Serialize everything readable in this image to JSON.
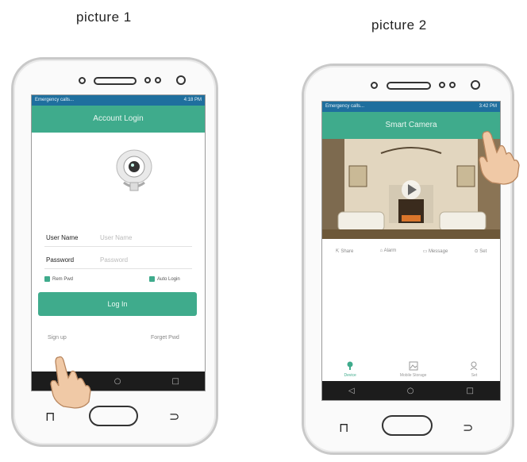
{
  "captions": {
    "picture1": "picture 1",
    "picture2": "picture 2"
  },
  "phone1": {
    "status_left": "Emergency calls...",
    "status_right": "4:18 PM",
    "title": "Account Login",
    "username_label": "User Name",
    "username_placeholder": "User Name",
    "password_label": "Password",
    "password_placeholder": "Password",
    "remember_pwd": "Rem Pwd",
    "auto_login": "Auto Login",
    "login_button": "Log In",
    "signup_link": "Sign up",
    "forgot_link": "Forget Pwd",
    "remember_pwd_checked": true,
    "auto_login_checked": true
  },
  "phone2": {
    "status_left": "Emergency calls...",
    "status_right": "3:42 PM",
    "title": "Smart Camera",
    "toolbar": [
      {
        "icon": "share-icon",
        "label": "Share"
      },
      {
        "icon": "alarm-icon",
        "label": "Alarm"
      },
      {
        "icon": "message-icon",
        "label": "Message"
      },
      {
        "icon": "settings-icon",
        "label": "Set"
      }
    ],
    "tabs": [
      {
        "icon": "device-icon",
        "label": "Device",
        "active": true
      },
      {
        "icon": "mobile-storage-icon",
        "label": "Mobile Storage",
        "active": false
      },
      {
        "icon": "user-icon",
        "label": "Set",
        "active": false
      }
    ]
  },
  "colors": {
    "accent": "#3fab8c",
    "statusbar": "#1f6f9e",
    "navbar": "#1c1c1c"
  }
}
